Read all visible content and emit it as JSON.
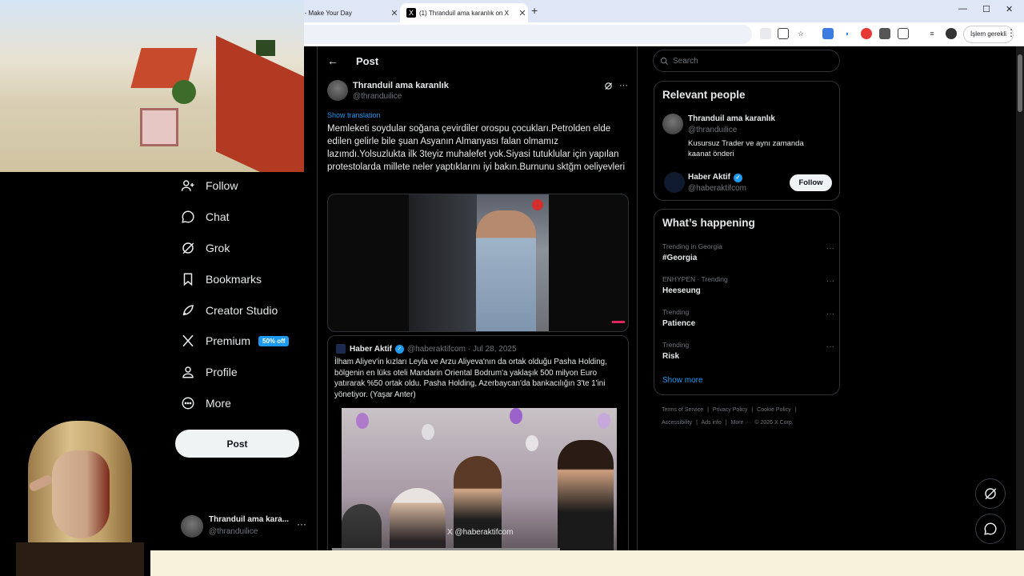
{
  "browser": {
    "tabs": [
      {
        "title": "ok - Make Your Day",
        "close": "✕"
      },
      {
        "title": "(1) Thranduil ama karanlık on X",
        "close": "✕",
        "favicon": "X"
      }
    ],
    "new_tab": "+",
    "window_controls": {
      "minimize": "—",
      "maximize": "☐",
      "close": "✕"
    },
    "update_button": "İşlem gerekli",
    "menu": "⋮"
  },
  "sidebar": {
    "items": [
      {
        "label": "Follow",
        "icon": "follow-icon"
      },
      {
        "label": "Chat",
        "icon": "chat-icon"
      },
      {
        "label": "Grok",
        "icon": "grok-icon"
      },
      {
        "label": "Bookmarks",
        "icon": "bookmark-icon"
      },
      {
        "label": "Creator Studio",
        "icon": "rocket-icon"
      },
      {
        "label": "Premium",
        "icon": "x-logo-icon",
        "badge": "50% off"
      },
      {
        "label": "Profile",
        "icon": "profile-icon"
      },
      {
        "label": "More",
        "icon": "more-icon"
      }
    ],
    "post_button": "Post",
    "account": {
      "name": "Thranduil ama kara...",
      "handle": "@thranduilice",
      "more": "···"
    }
  },
  "main": {
    "header": {
      "back": "←",
      "title": "Post"
    },
    "post": {
      "name": "Thranduil ama karanlık",
      "handle": "@thranduilice",
      "more": "···",
      "show_translation": "Show translation",
      "text": "Memleketi soydular soğana çevirdiler orospu çocukları.Petrolden elde edilen gelirle bile şuan Asyanın Almanyası falan olmamız lazımdı.Yolsuzlukta ilk 3teyiz muhalefet yok.Siyasi tutuklular için yapılan protestolarda  millete neler yaptıklarını iyi bakın.Burnunu sktğm oeliyevleri"
    },
    "quote": {
      "name": "Haber Aktif",
      "handle": "@haberaktifcom",
      "date": "· Jul 28, 2025",
      "text": "İlham Aliyev'in kızları Leyla ve Arzu Aliyeva'nın da ortak olduğu Pasha Holding, bölgenin en lüks oteli Mandarin Oriental Bodrum'a yaklaşık 500 milyon Euro yatırarak %50 ortak oldu. Pasha Holding, Azerbaycan'da bankacılığın 3'te 1'ini yönetiyor. (Yaşar Anter)",
      "watermark": "X @haberaktifcom"
    }
  },
  "right": {
    "search_placeholder": "Search",
    "relevant": {
      "title": "Relevant people",
      "people": [
        {
          "name": "Thranduil ama karanlık",
          "handle": "@thranduilice",
          "bio": "Kusursuz Trader ve aynı zamanda kaanat önderi"
        },
        {
          "name": "Haber Aktif",
          "handle": "@haberaktifcom",
          "follow": "Follow"
        }
      ]
    },
    "happening": {
      "title": "What’s happening",
      "trends": [
        {
          "context": "Trending in Georgia",
          "topic": "#Georgia"
        },
        {
          "context": "ENHYPEN · Trending",
          "topic": "Heeseung"
        },
        {
          "context": "Trending",
          "topic": "Patience"
        },
        {
          "context": "Trending",
          "topic": "Risk"
        }
      ],
      "show_more": "Show more"
    },
    "footer": {
      "line1": [
        "Terms of Service",
        "|",
        "Privacy Policy",
        "|",
        "Cookie Policy",
        "|"
      ],
      "line2": [
        "Accessibility",
        "|",
        "Ads info",
        "|",
        "More ···",
        "© 2026 X Corp."
      ]
    }
  },
  "colors": {
    "accent": "#1d9bf0",
    "background": "#000000",
    "text": "#e7e9ea",
    "muted": "#71767b"
  }
}
